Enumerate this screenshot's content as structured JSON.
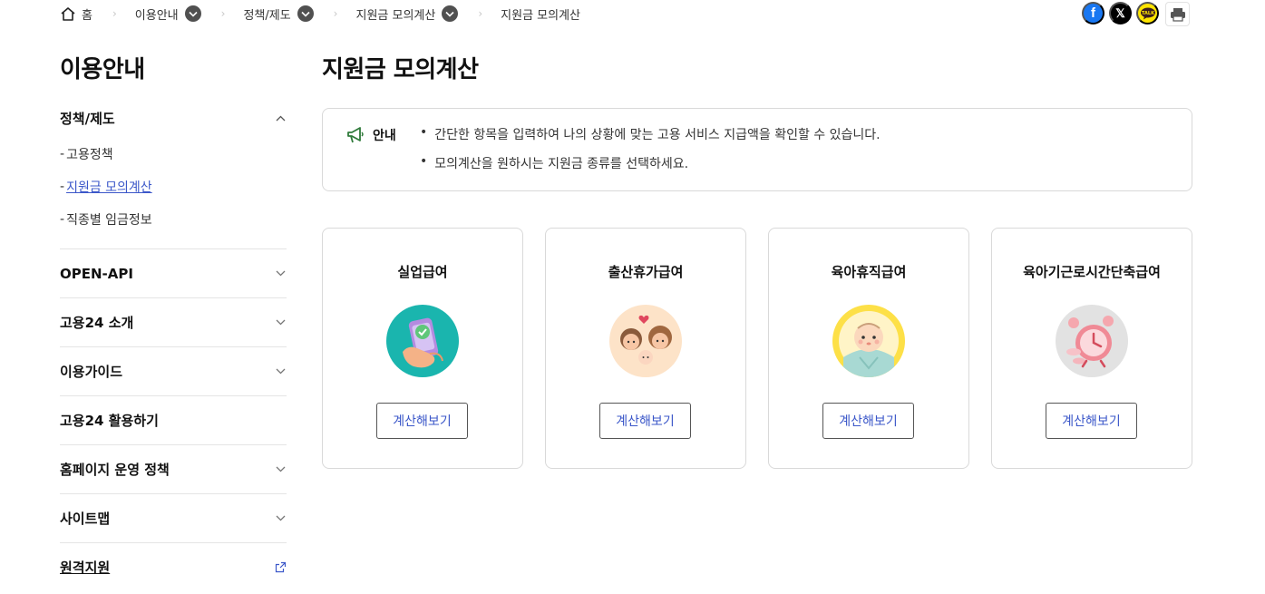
{
  "breadcrumb": {
    "home": "홈",
    "items": [
      "이용안내",
      "정책/제도",
      "지원금 모의계산"
    ],
    "current": "지원금 모의계산"
  },
  "share": {
    "facebook_icon": "facebook-icon",
    "x_icon": "x-icon",
    "kakaotalk_icon": "kakaotalk-icon",
    "print_icon": "print-icon",
    "facebook_glyph": "f",
    "x_glyph": "𝕏"
  },
  "sidebar": {
    "title": "이용안내",
    "groups": [
      {
        "label": "정책/제도",
        "expanded": true,
        "items": [
          {
            "label": "고용정책",
            "active": false
          },
          {
            "label": "지원금 모의계산",
            "active": true
          },
          {
            "label": "직종별 임금정보",
            "active": false
          }
        ]
      },
      {
        "label": "OPEN-API"
      },
      {
        "label": "고용24 소개"
      },
      {
        "label": "이용가이드"
      },
      {
        "label": "고용24 활용하기"
      },
      {
        "label": "홈페이지 운영 정책"
      },
      {
        "label": "사이트맵"
      },
      {
        "label": "원격지원",
        "external": true
      }
    ],
    "dash": "-"
  },
  "main": {
    "title": "지원금 모의계산",
    "notice": {
      "label": "안내",
      "bullet": "•",
      "lines": [
        "간단한 항목을 입력하여 나의 상황에 맞는 고용 서비스 지급액을 확인할 수 있습니다.",
        "모의계산을 원하시는 지원금 종류를 선택하세요."
      ]
    },
    "cards": [
      {
        "title": "실업급여",
        "button": "계산해보기",
        "icon": "phone-check-icon",
        "icon_bg": "#1ab5ae"
      },
      {
        "title": "출산휴가급여",
        "button": "계산해보기",
        "icon": "family-icon",
        "icon_bg": "#fde3c8"
      },
      {
        "title": "육아휴직급여",
        "button": "계산해보기",
        "icon": "baby-icon",
        "icon_bg": "#fde047"
      },
      {
        "title": "육아기근로시간단축급여",
        "button": "계산해보기",
        "icon": "alarm-clock-icon",
        "icon_bg": "#e2e2e2"
      }
    ]
  },
  "colors": {
    "accent": "#3b57c9",
    "notice_icon": "#2f7a3a"
  }
}
